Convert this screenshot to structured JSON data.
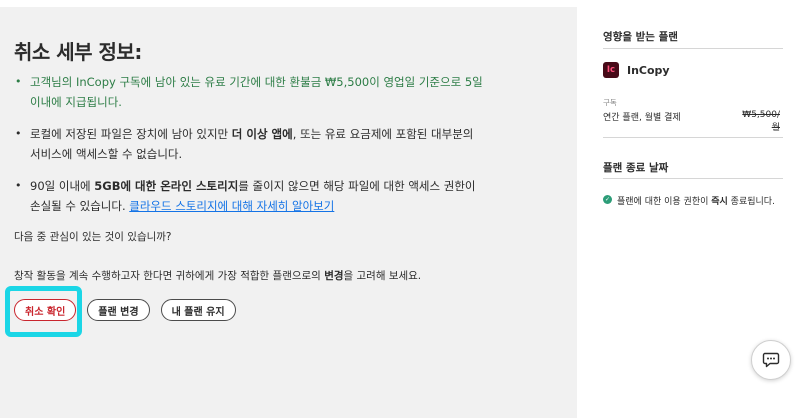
{
  "page": {
    "title": "취소 세부 정보:"
  },
  "details": {
    "bullet1": "고객님의 InCopy 구독에 남아 있는 유료 기간에 대한 환불금 ₩5,500이 영업일 기준으로 5일 이내에 지급됩니다.",
    "bullet2_pre": "로컬에 저장된 파일은 장치에 남아 있지만 ",
    "bullet2_bold": "더 이상 앱에",
    "bullet2_post": ", 또는 유료 요금제에 포함된 대부분의 서비스에 액세스할 수 없습니다.",
    "bullet3_pre": "90일 이내에 ",
    "bullet3_bold": "5GB에 대한 온라인 스토리지",
    "bullet3_post": "를 줄이지 않으면 해당 파일에 대한 액세스 권한이 손실될 수 있습니다. ",
    "bullet3_link": "클라우드 스토리지에 대해 자세히 알아보기"
  },
  "question": "다음 중 관심이 있는 것이 있습니까?",
  "suggestion": {
    "pre": "창작 활동을 계속 수행하고자 한다면 귀하에게 가장 적합한 플랜으로의 ",
    "bold": "변경",
    "post": "을 고려해 보세요."
  },
  "buttons": {
    "confirm_cancel": "취소 확인",
    "change_plan": "플랜 변경",
    "keep_plan": "내 플랜 유지"
  },
  "sidebar": {
    "affected_title": "영향을 받는 플랜",
    "product_icon_text": "Ic",
    "product_name": "InCopy",
    "purchase_label": "구독",
    "plan_type": "연간 플랜, 월별 결제",
    "plan_price": "₩5,500/월",
    "end_title": "플랜 종료 날짜",
    "end_pre": "플랜에 대한 이용 권한이 ",
    "end_bold": "즉시",
    "end_post": " 종료됩니다."
  },
  "icons": {
    "product": "incopy-logo-icon",
    "check": "check-circle-icon",
    "chat": "chat-icon"
  },
  "colors": {
    "accent_green": "#2d7d46",
    "danger": "#c9252d",
    "link": "#1473e6",
    "highlight": "#1bd6e6"
  }
}
